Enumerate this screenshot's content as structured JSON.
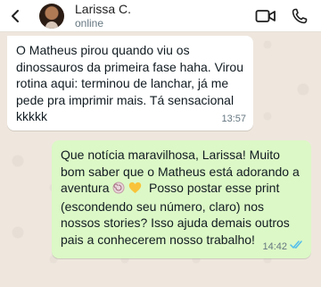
{
  "contact": {
    "name": "Larissa C.",
    "status": "online"
  },
  "messages": [
    {
      "direction": "incoming",
      "line1": "O Matheus pirou quando viu os",
      "line2": "dinossauros da primeira fase haha. Virou",
      "line3": "rotina aqui: terminou de lanchar, já me",
      "line4": "pede pra imprimir mais. Tá sensacional",
      "line5": "kkkkk",
      "time": "13:57"
    },
    {
      "direction": "outgoing",
      "line1": "Que notícia maravilhosa, Larissa! Muito",
      "line2": "bom saber que o Matheus está adorando a",
      "line3a": "aventura",
      "line3b": "Posso postar esse print",
      "line4": "(escondendo seu número, claro) nos",
      "line5": "nossos stories? Isso ajuda demais outros",
      "line6": "pais a conhecerem nosso trabalho!",
      "time": "14:42",
      "emojis": [
        "shell-emoji",
        "yellow-heart-emoji"
      ],
      "read_status": "read"
    }
  ],
  "colors": {
    "outgoing_bubble": "#dcf8c6",
    "incoming_bubble": "#ffffff",
    "read_ticks": "#53bdeb"
  }
}
